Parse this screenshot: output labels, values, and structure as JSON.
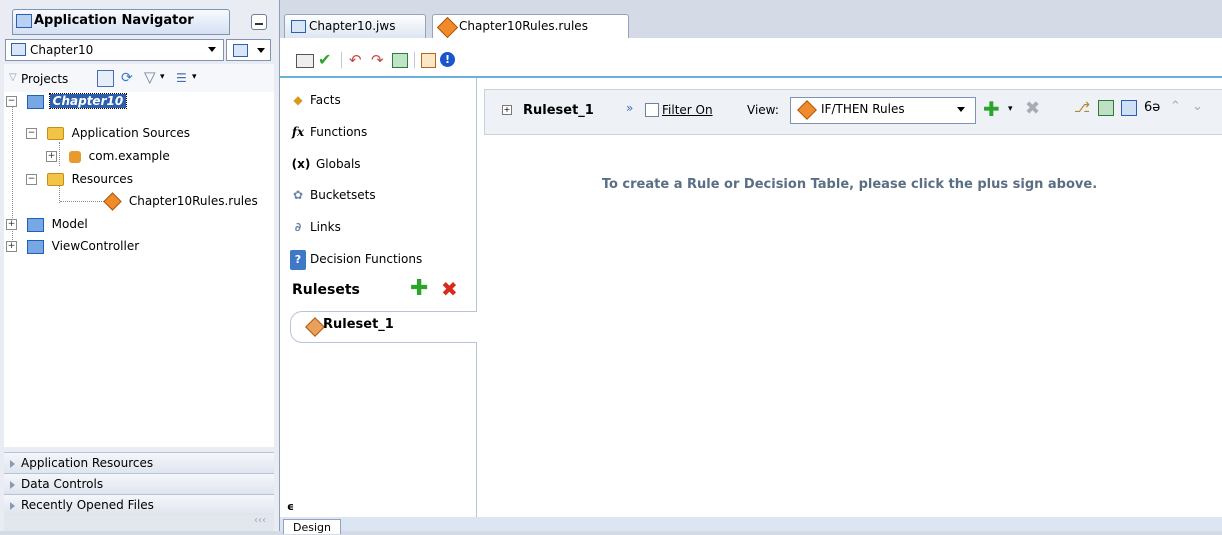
{
  "navigator": {
    "title": "Application Navigator",
    "project_selector": "Chapter10",
    "projects_label": "Projects",
    "tree": [
      {
        "label": "Chapter10",
        "selected": true
      },
      {
        "label": "Application Sources"
      },
      {
        "label": "com.example"
      },
      {
        "label": "Resources"
      },
      {
        "label": "Chapter10Rules.rules"
      },
      {
        "label": "Model"
      },
      {
        "label": "ViewController"
      }
    ],
    "accordions": [
      "Application Resources",
      "Data Controls",
      "Recently Opened Files"
    ]
  },
  "editor": {
    "tabs": [
      {
        "label": "Chapter10.jws",
        "active": false
      },
      {
        "label": "Chapter10Rules.rules",
        "active": true
      }
    ],
    "side_items": [
      {
        "label": "Facts",
        "icon": "facts-icon"
      },
      {
        "label": "Functions",
        "icon": "functions-icon"
      },
      {
        "label": "Globals",
        "icon": "globals-icon"
      },
      {
        "label": "Bucketsets",
        "icon": "bucketsets-icon"
      },
      {
        "label": "Links",
        "icon": "links-icon"
      },
      {
        "label": "Decision Functions",
        "icon": "decision-functions-icon"
      }
    ],
    "rulesets_title": "Rulesets",
    "ruleset_item": "Ruleset_1",
    "header": {
      "ruleset_name": "Ruleset_1",
      "filter_label": "Filter On",
      "view_label": "View:",
      "view_value": "IF/THEN Rules"
    },
    "empty_message": "To create a Rule or Decision Table, please click the plus sign above.",
    "design_tab": "Design"
  },
  "colors": {
    "accent": "#6ab0d8",
    "add_green": "#2aa52a",
    "delete_red": "#d92b1b",
    "folder": "#f2c447",
    "rules_diamond": "#f08b2c"
  }
}
